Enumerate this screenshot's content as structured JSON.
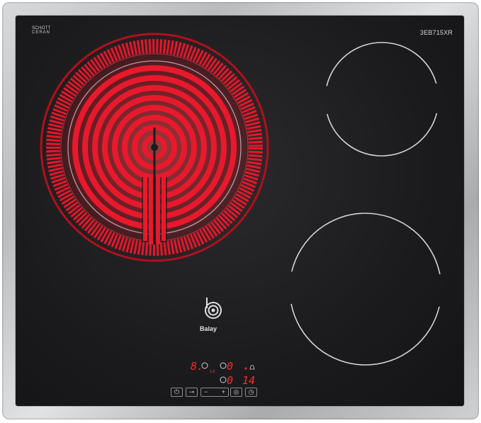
{
  "brand": {
    "glass_maker_line1": "SCHOTT",
    "glass_maker_line2": "CERAN",
    "glass_maker_line3": "",
    "model": "3EB715XR",
    "name": "Balay"
  },
  "display": {
    "zone_level": "8.",
    "zone_a": "0",
    "zone_b": "0",
    "timer": "14",
    "indicator_hi": "1-6"
  },
  "controls": {
    "power": "⏻",
    "lock": "⊸",
    "minus": "−",
    "plus": "+",
    "zone": "◎",
    "timer": "◷"
  },
  "colors": {
    "glass": "#1b1b1d",
    "heater_red": "#e8192c",
    "led_red": "#ff2a2a"
  }
}
